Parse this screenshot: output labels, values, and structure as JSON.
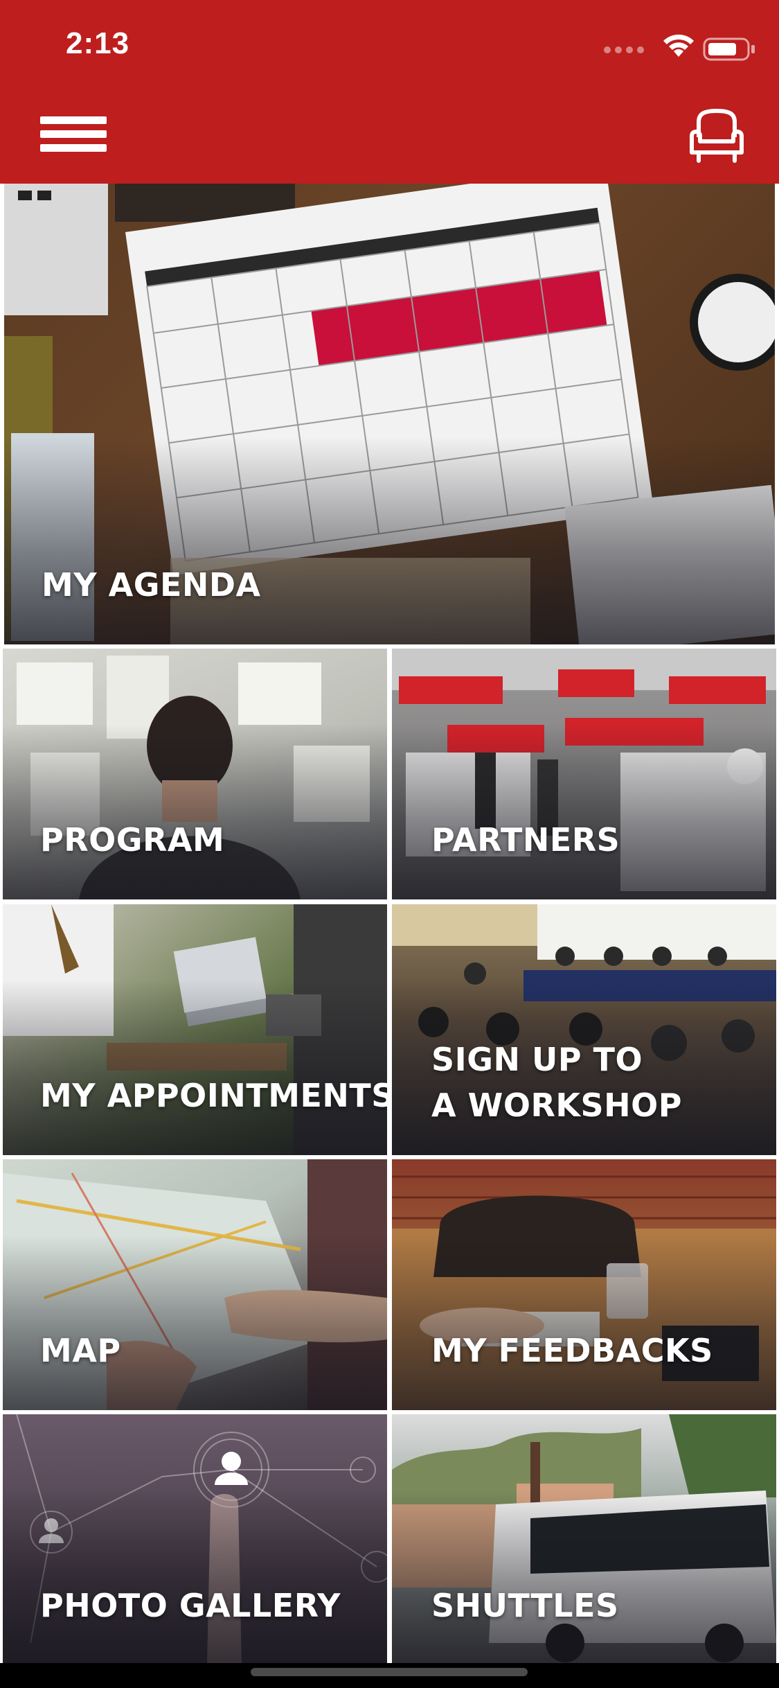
{
  "status_bar": {
    "time": "2:13"
  },
  "app_bar": {
    "menu_icon": "hamburger-menu-icon",
    "right_icon": "armchair-icon"
  },
  "tiles": [
    {
      "name": "my-agenda",
      "label_lines": [
        "MY AGENDA"
      ]
    },
    {
      "name": "program",
      "label_lines": [
        "PROGRAM"
      ]
    },
    {
      "name": "partners",
      "label_lines": [
        "PARTNERS"
      ]
    },
    {
      "name": "my-appointments",
      "label_lines": [
        "MY APPOINTMENTS"
      ]
    },
    {
      "name": "sign-up-workshop",
      "label_lines": [
        "SIGN UP TO",
        "A WORKSHOP"
      ]
    },
    {
      "name": "map",
      "label_lines": [
        "MAP"
      ]
    },
    {
      "name": "my-feedbacks",
      "label_lines": [
        "MY FEEDBACKS"
      ]
    },
    {
      "name": "photo-gallery",
      "label_lines": [
        "PHOTO GALLERY"
      ]
    },
    {
      "name": "shuttles",
      "label_lines": [
        "SHUTTLES"
      ]
    }
  ],
  "colors": {
    "brand_red": "#be1e1e",
    "label_text": "#ffffff"
  }
}
